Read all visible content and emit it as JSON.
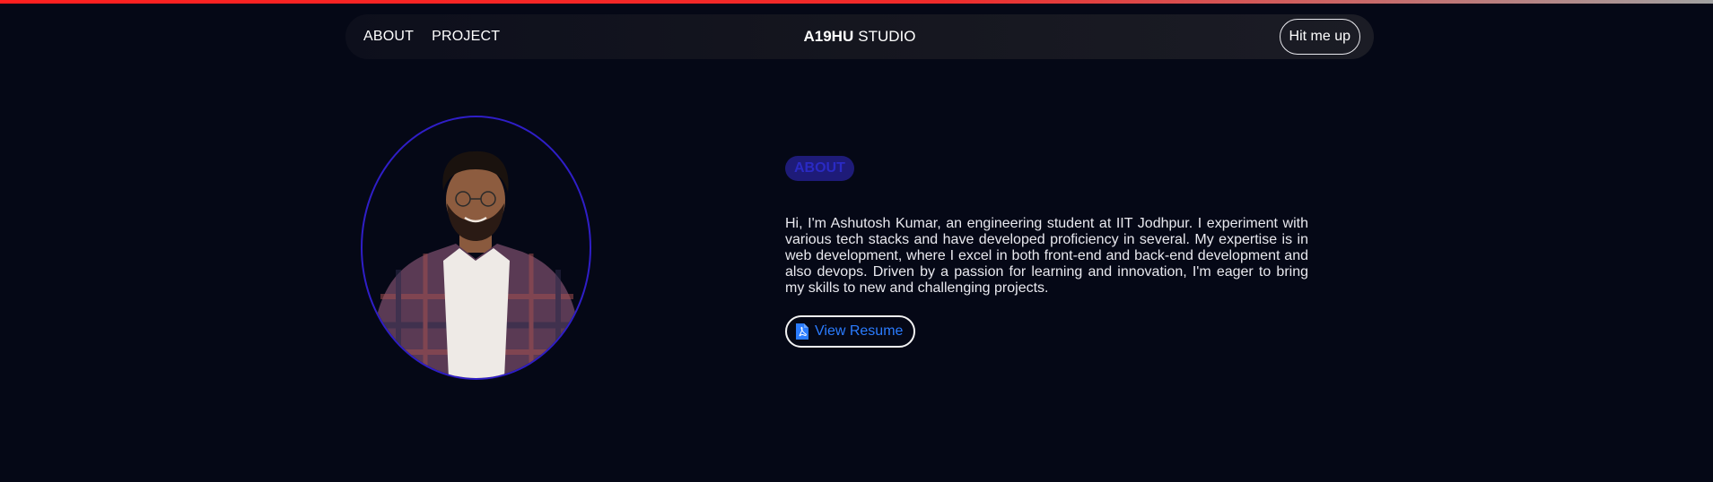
{
  "colors": {
    "background": "#050816",
    "accent_blue": "#2b7cff",
    "badge_bg": "#1e1b78",
    "avatar_ring": "#2f1ec7",
    "progress_red": "#ff1f1f"
  },
  "nav": {
    "links": [
      {
        "label": "ABOUT"
      },
      {
        "label": "PROJECT"
      }
    ],
    "brand_strong": "A19HU",
    "brand_light": "STUDIO",
    "cta_label": "Hit me up"
  },
  "about": {
    "badge": "ABOUT",
    "text": "Hi, I'm Ashutosh Kumar, an engineering student at IIT Jodhpur. I experiment with various tech stacks and have developed proficiency in several. My expertise is in web development, where I excel in both front-end and back-end development and also devops. Driven by a passion for learning and innovation, I'm eager to bring my skills to new and challenging projects.",
    "resume_label": "View Resume",
    "resume_icon": "pdf-file-icon"
  },
  "avatar": {
    "icon": "profile-photo"
  }
}
